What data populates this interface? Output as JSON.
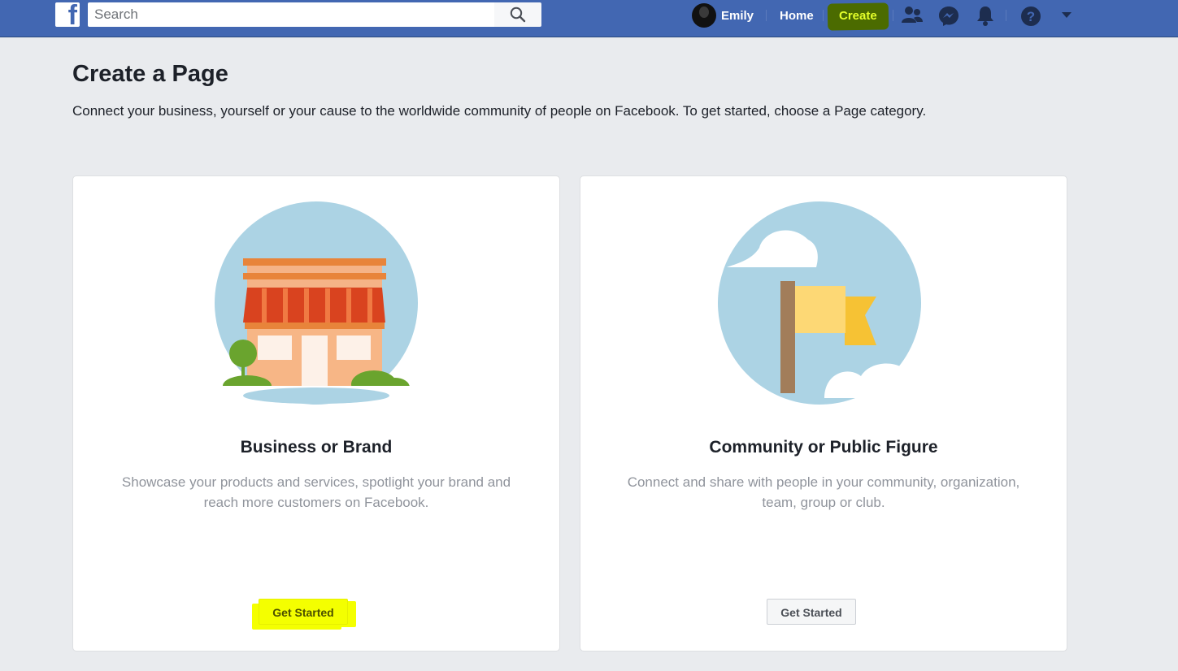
{
  "topbar": {
    "logo_letter": "f",
    "search": {
      "placeholder": "Search",
      "value": ""
    },
    "user_name": "Emily",
    "home_label": "Home",
    "create_label": "Create",
    "icons": [
      "friends-icon",
      "messenger-icon",
      "notifications-icon",
      "help-icon",
      "dropdown-icon"
    ],
    "colors": {
      "bar": "#4267b2",
      "create_highlight": "#4b6b00",
      "create_text": "#e4ff2a"
    }
  },
  "main": {
    "title": "Create a Page",
    "subtitle": "Connect your business, yourself or your cause to the worldwide community of people on Facebook. To get started, choose a Page category.",
    "cards": [
      {
        "title": "Business or Brand",
        "description": "Showcase your products and services, spotlight your brand and reach more customers on Facebook.",
        "button_label": "Get Started",
        "button_highlight": "#f4ff00",
        "illustration": "storefront-illustration"
      },
      {
        "title": "Community or Public Figure",
        "description": "Connect and share with people in your community, organization, team, group or club.",
        "button_label": "Get Started",
        "illustration": "flag-illustration"
      }
    ]
  }
}
